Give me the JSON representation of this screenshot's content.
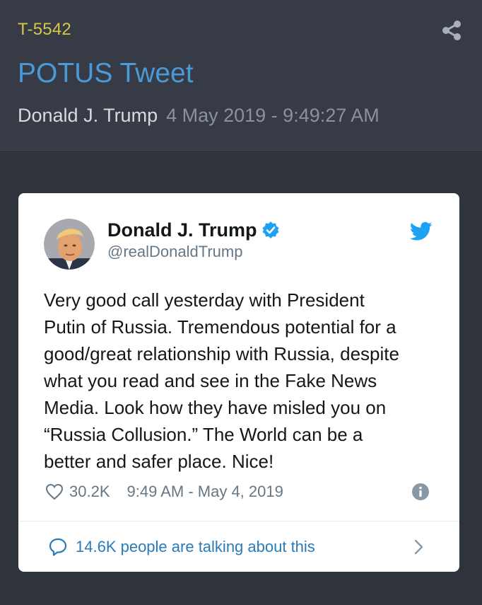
{
  "header": {
    "post_id": "T-5542",
    "title": "POTUS Tweet",
    "author": "Donald J. Trump",
    "datetime": "4 May 2019 - 9:49:27 AM"
  },
  "tweet": {
    "display_name": "Donald J. Trump",
    "handle": "@realDonaldTrump",
    "text_lines": [
      "Very good call yesterday with President",
      "Putin of Russia. Tremendous potential for a",
      "good/great relationship with Russia, despite",
      "what you read and see in the Fake News",
      "Media. Look how they have misled you on",
      "“Russia Collusion.” The World can be a",
      "better and safer place. Nice!"
    ],
    "likes": "30.2K",
    "timestamp": "9:49 AM - May 4, 2019",
    "talking": "14.6K people are talking about this"
  },
  "icons": {
    "share": "share-icon",
    "verified": "verified-badge-icon",
    "twitter": "twitter-bird-icon",
    "like": "heart-icon",
    "info": "info-icon",
    "comment": "comment-icon",
    "chevron": "chevron-right-icon"
  },
  "colors": {
    "background": "#2f333c",
    "header_panel": "#363b45",
    "post_id": "#d8c64a",
    "title": "#4b9ad8",
    "twitter_blue": "#1da1f2",
    "link_blue": "#2b7bb9"
  }
}
